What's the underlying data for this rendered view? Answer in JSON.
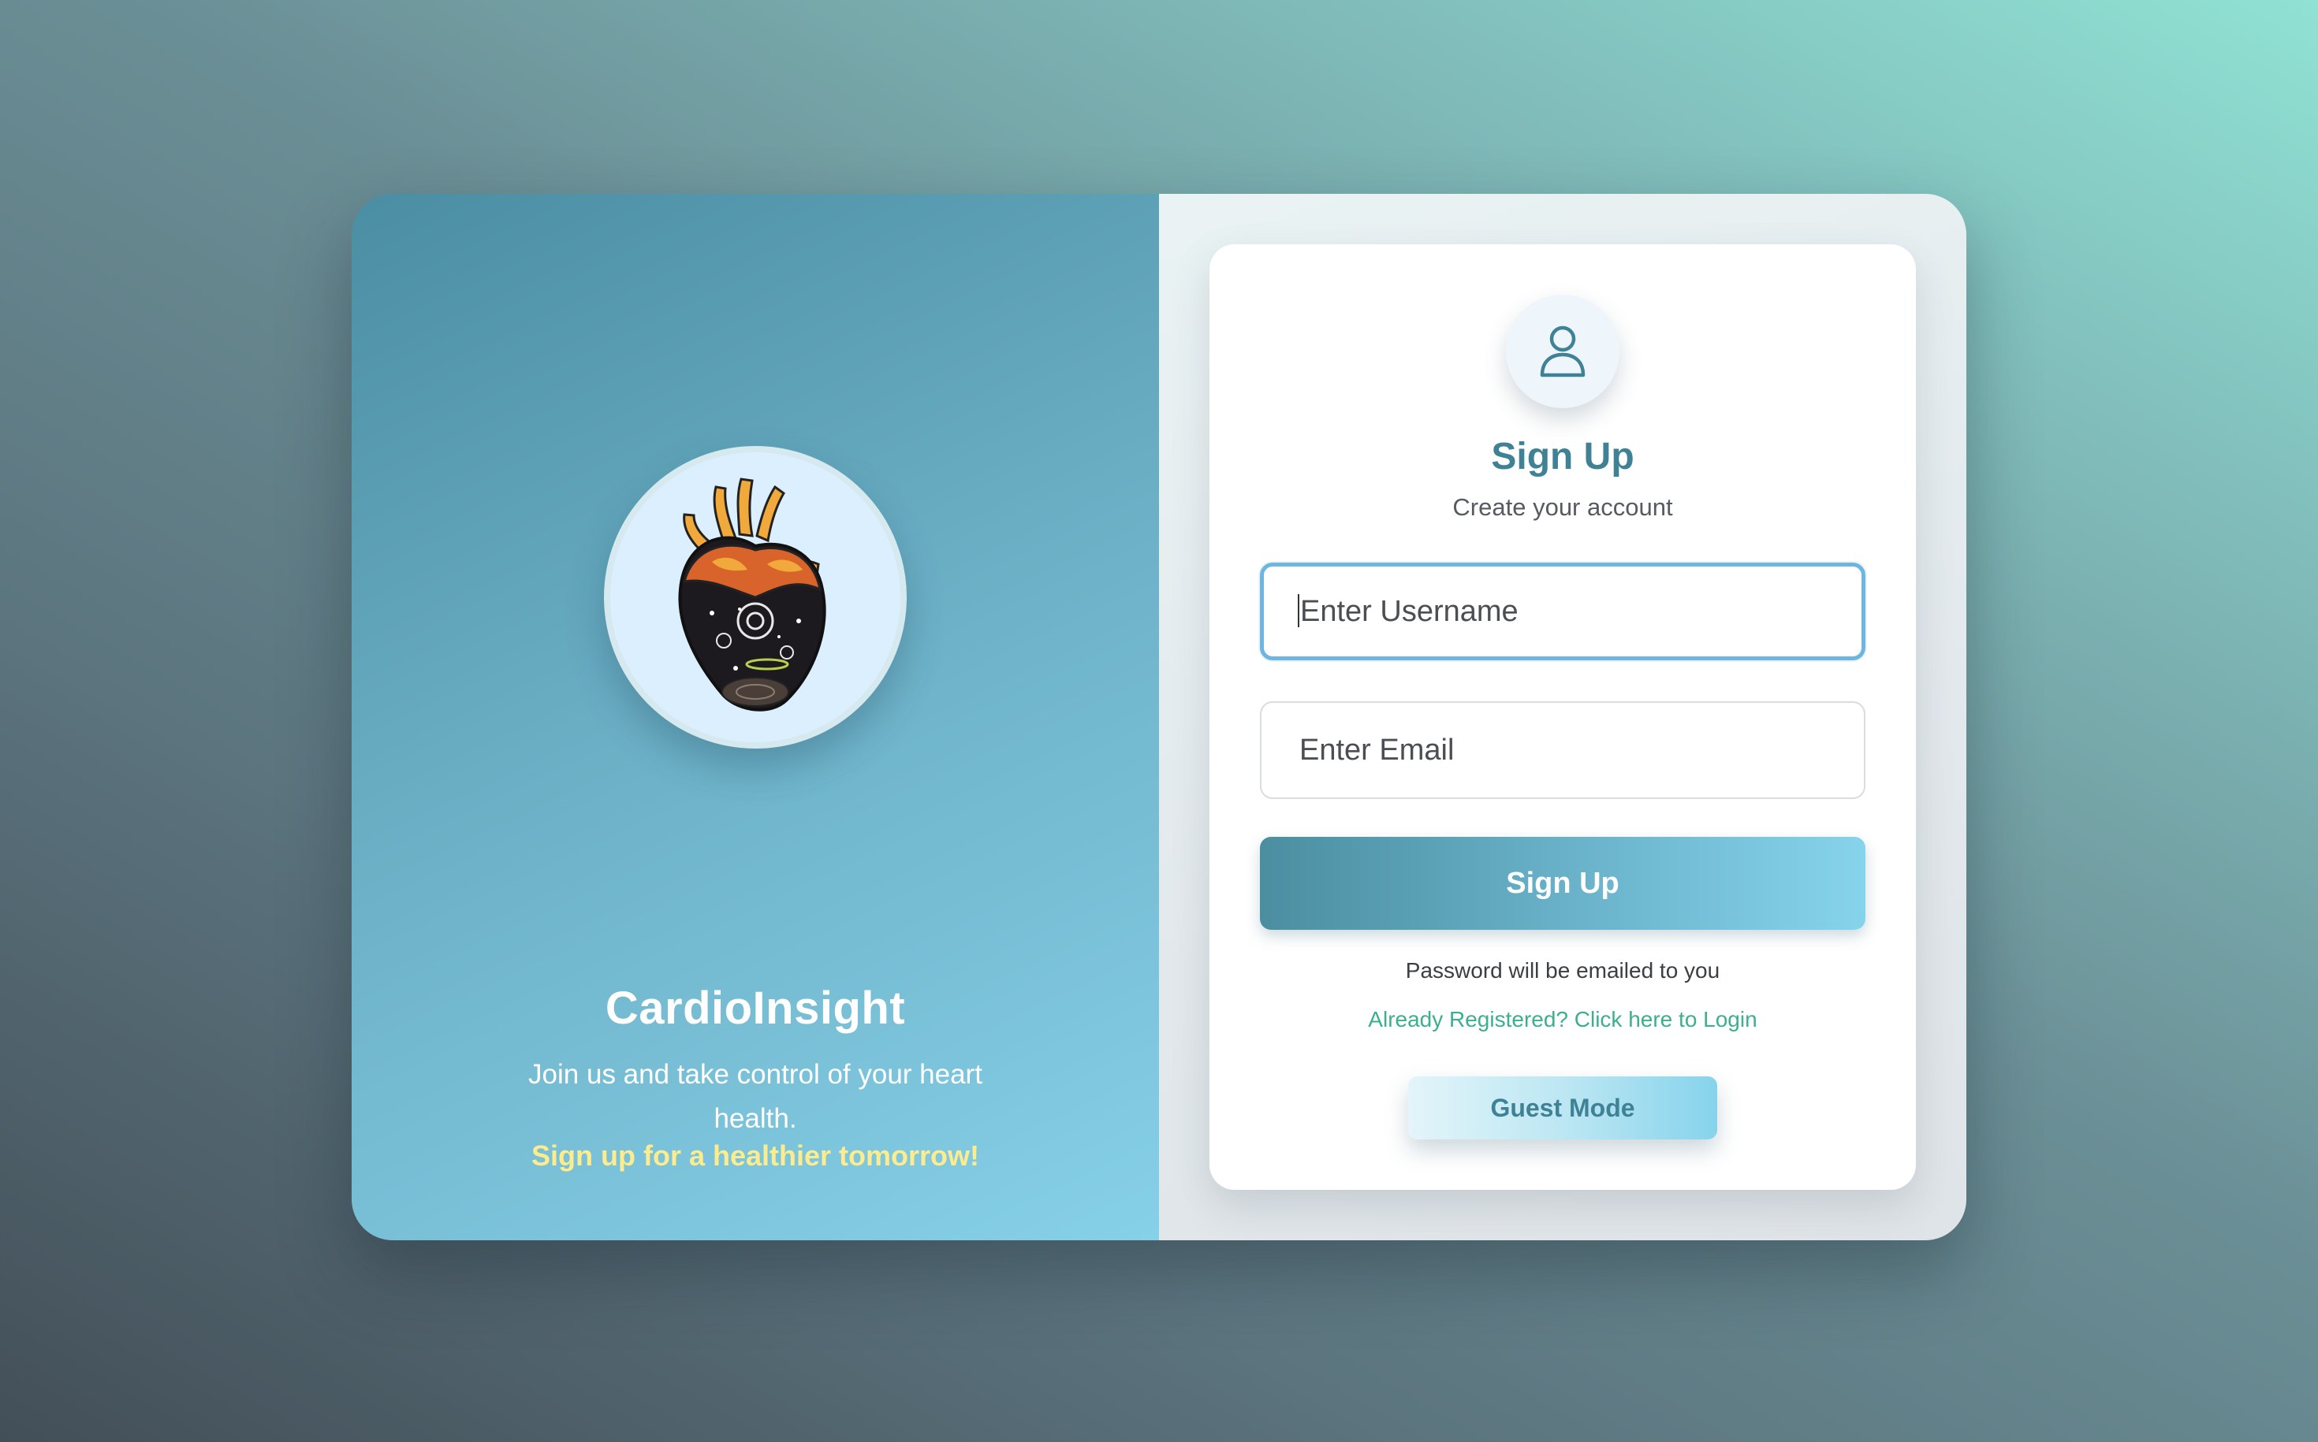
{
  "brand": {
    "name": "CardioInsight",
    "tagline": "Join us and take control of your heart health.",
    "cta": "Sign up for a healthier tomorrow!",
    "logo_icon": "heart-illustration-icon"
  },
  "form": {
    "avatar_icon": "user-icon",
    "title": "Sign Up",
    "subtitle": "Create your account",
    "username_placeholder": "Enter Username",
    "email_placeholder": "Enter Email",
    "submit_label": "Sign Up",
    "note": "Password will be emailed to you",
    "login_link": "Already Registered? Click here to Login",
    "guest_label": "Guest Mode"
  },
  "colors": {
    "accent": "#3f8296",
    "cta_yellow": "#fcec8e",
    "link_green": "#3bb08d",
    "focus_blue": "#6eb5e0"
  }
}
